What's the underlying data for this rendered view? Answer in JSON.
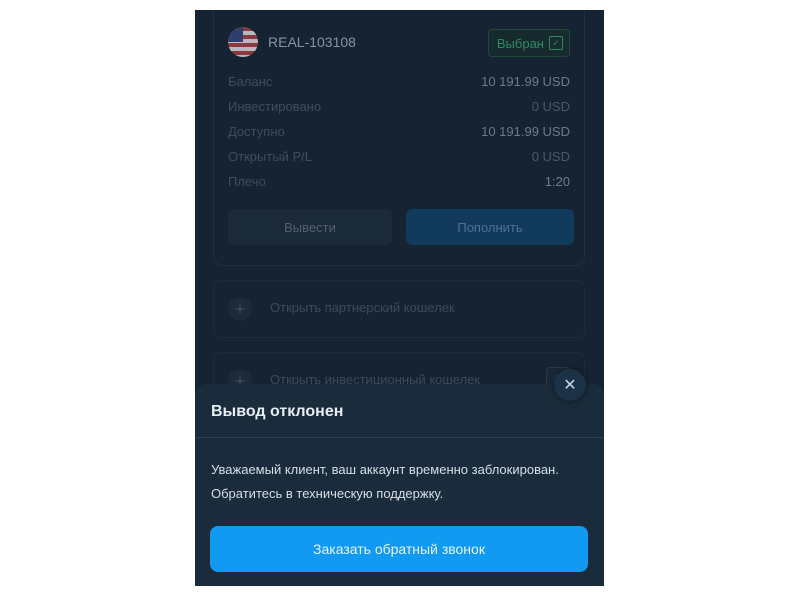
{
  "account": {
    "id": "REAL-103108",
    "selected_label": "Выбран",
    "rows": [
      {
        "label": "Баланс",
        "value": "10 191.99 USD"
      },
      {
        "label": "Инвестировано",
        "value": "0 USD"
      },
      {
        "label": "Доступно",
        "value": "10 191.99 USD"
      },
      {
        "label": "Открытый P/L",
        "value": "0 USD"
      },
      {
        "label": "Плечо",
        "value": "1:20"
      }
    ],
    "withdraw_label": "Вывести",
    "deposit_label": "Пополнить"
  },
  "wallets": [
    {
      "label": "Открыть партнерский кошелек"
    },
    {
      "label": "Открыть инвестиционный кошелек"
    }
  ],
  "dialog": {
    "title": "Вывод отклонен",
    "message_line1": "Уважаемый клиент, ваш аккаунт временно заблокирован.",
    "message_line2": "Обратитесь в техническую поддержку.",
    "cta_label": "Заказать обратный звонок",
    "close_glyph": "✕"
  },
  "icons": {
    "plus": "+",
    "check": "✓"
  },
  "colors": {
    "background": "#162332",
    "sheet": "#1a2b3b",
    "accent": "#119af2",
    "selected_green": "#2d8a5e"
  }
}
